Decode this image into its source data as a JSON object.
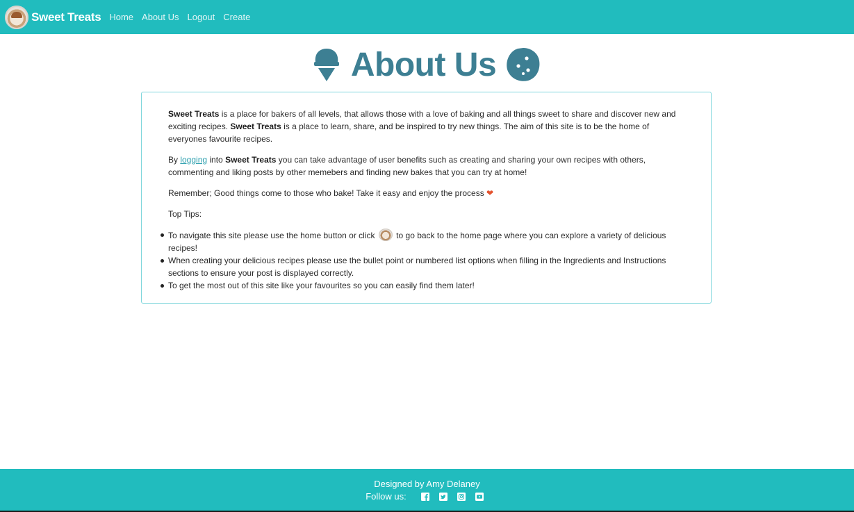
{
  "colors": {
    "brand": "#21bcbe",
    "heading": "#3d7f93",
    "card_border": "#7fd6dc",
    "link": "#2b9fae",
    "heart": "#e4532f"
  },
  "navbar": {
    "logo_icon": "cupcake-logo",
    "brand_name": "Sweet Treats",
    "links": [
      "Home",
      "About Us",
      "Logout",
      "Create"
    ]
  },
  "heading": {
    "title": "About Us",
    "left_icon": "ice-cream-icon",
    "right_icon": "cookie-icon"
  },
  "content": {
    "p1": {
      "brand": "Sweet Treats",
      "text_a": " is a place for bakers of all levels, that allows those with a love of baking and all things sweet to share and discover new and exciting recipes. ",
      "brand2": "Sweet Treats",
      "text_b": " is a place to learn, share, and be inspired to try new things. The aim of this site is to be the home of everyones favourite recipes."
    },
    "p2": {
      "prefix": "By ",
      "link": "logging",
      "mid": " into ",
      "brand": "Sweet Treats",
      "suffix": " you can take advantage of user benefits such as creating and sharing your own recipes with others, commenting and liking posts by other memebers and finding new bakes that you can try at home!"
    },
    "p3": {
      "text": "Remember; Good things come to those who bake! Take it easy and enjoy the process ",
      "heart_icon": "heart-icon",
      "heart_glyph": "❤"
    },
    "tips_label": "Top Tips:",
    "tips": [
      {
        "before": "To navigate this site please use the home button or click ",
        "after": " to go back to the home page where you can explore a variety of delicious recipes!"
      },
      {
        "before": "When creating your delicious recipes please use the bullet point or numbered list options when filling in the Ingredients and Instructions sections to ensure your post is displayed correctly."
      },
      {
        "before": "To get the most out of this site like your favourites so you can easily find them later!"
      }
    ]
  },
  "footer": {
    "credit": "Designed by Amy Delaney",
    "follow_label": "Follow us:",
    "social_icons": [
      "facebook-icon",
      "twitter-icon",
      "instagram-icon",
      "youtube-icon"
    ]
  }
}
